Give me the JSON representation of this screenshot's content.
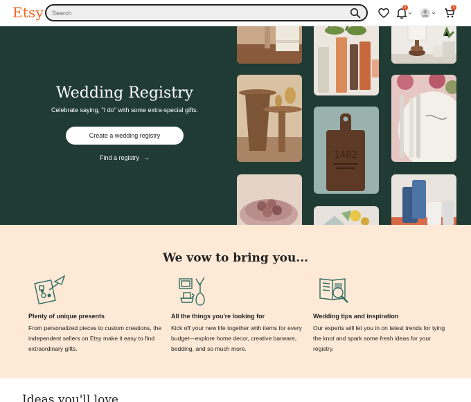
{
  "header": {
    "logo": "Etsy",
    "search_placeholder": "Search",
    "notifications_badge": "1",
    "cart_badge": "1",
    "icons": [
      "search-icon",
      "heart-icon",
      "bell-icon",
      "avatar-icon",
      "cart-icon"
    ]
  },
  "hero": {
    "title": "Wedding Registry",
    "subtitle": "Celebrate saying, \"I do\" with some extra-special gifts.",
    "create_button": "Create a wedding registry",
    "find_link": "Find a registry",
    "find_arrow": "→",
    "cutting_board_text": "1482"
  },
  "vow": {
    "title": "We vow to bring you...",
    "features": [
      {
        "icon": "gift-collage-icon",
        "title": "Plenty of unique presents",
        "body": "From personalized pieces to custom creations, the independent sellers on Etsy make it easy to find extraordinary gifts."
      },
      {
        "icon": "home-goods-icon",
        "title": "All the things you're looking for",
        "body": "Kick off your new life together with items for every budget—explore home decor, creative barware, bedding, and so much more."
      },
      {
        "icon": "book-magnifier-icon",
        "title": "Wedding tips and inspiration",
        "body": "Our experts will let you in on latest trends for tying the knot and spark some fresh ideas for your registry."
      }
    ]
  },
  "bottom": {
    "title": "Ideas you'll love"
  },
  "colors": {
    "brand": "#f1641e",
    "hero_bg": "#1f3b34",
    "vow_bg": "#fde9d6",
    "badge": "#e0552c"
  }
}
